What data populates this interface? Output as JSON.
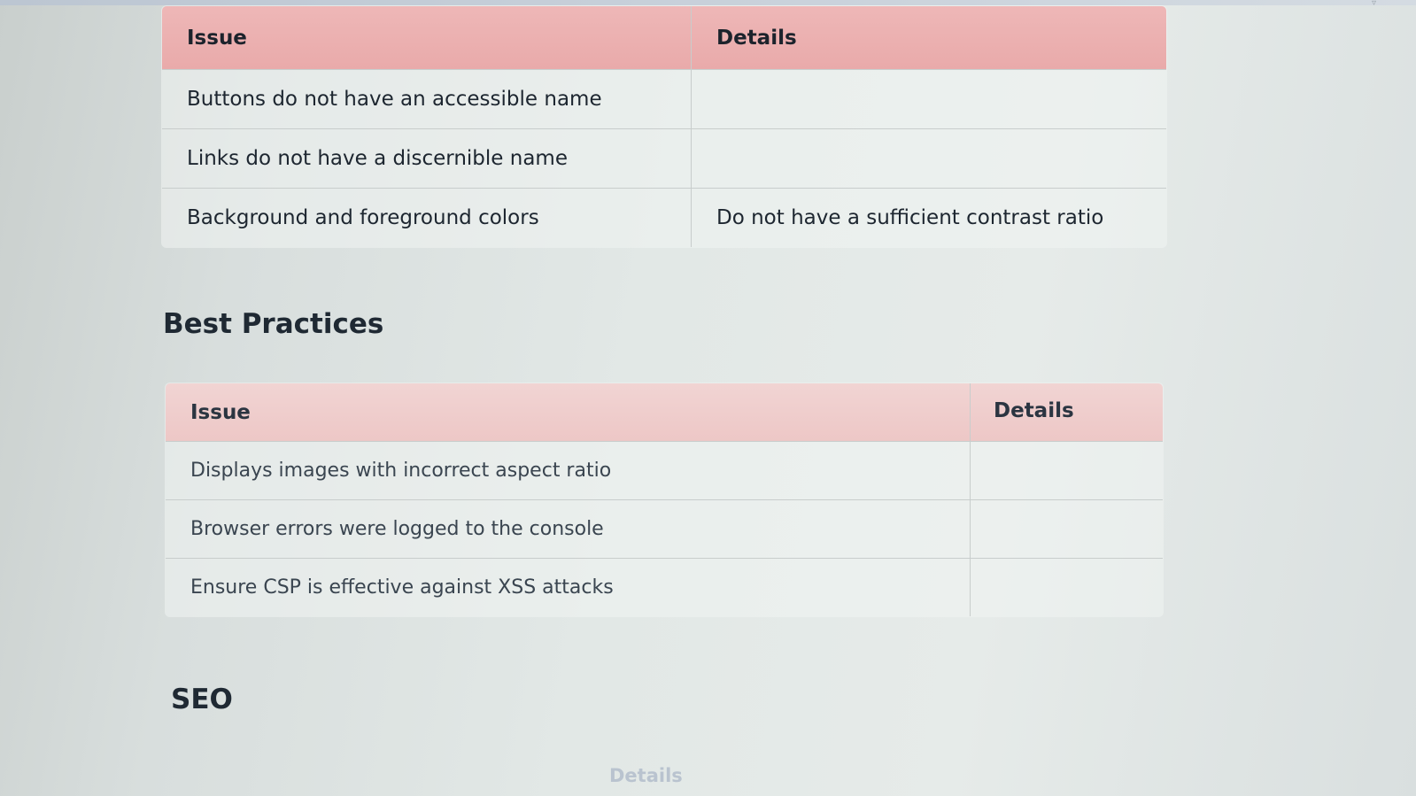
{
  "accessibility_table": {
    "headers": [
      "Issue",
      "Details"
    ],
    "rows": [
      {
        "issue": "Buttons do not have an accessible name",
        "details": ""
      },
      {
        "issue": "Links do not have a discernible name",
        "details": ""
      },
      {
        "issue": "Background and foreground colors",
        "details": "Do not have a sufficient contrast ratio"
      }
    ]
  },
  "best_practices": {
    "heading": "Best Practices",
    "headers": [
      "Issue",
      "Details"
    ],
    "rows": [
      {
        "issue": "Displays images with incorrect aspect ratio",
        "details": ""
      },
      {
        "issue": "Browser errors were logged to the console",
        "details": ""
      },
      {
        "issue": "Ensure CSP is effective against XSS attacks",
        "details": ""
      }
    ]
  },
  "seo": {
    "heading": "SEO",
    "partial_header": "Details"
  },
  "colors": {
    "header_accent": "#e9aaaa",
    "header_light": "#edc7c6",
    "text": "#1f2730"
  }
}
